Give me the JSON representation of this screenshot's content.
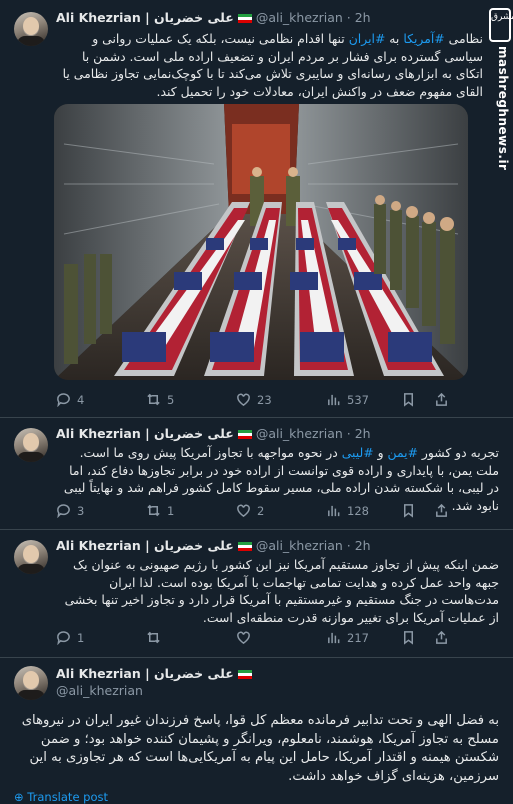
{
  "watermark": {
    "site": "mashreghnews.ir",
    "logo": "مشرق"
  },
  "author": {
    "name": "Ali Khezrian | علی خضریان",
    "handle": "@ali_khezrian",
    "dot": "·"
  },
  "tweets": [
    {
      "time": "2h",
      "text_html": "نظامی <span class=\"tag\">#آمریکا</span> به <span class=\"tag\">#ایران</span> تنها اقدام نظامی نیست، بلکه یک عملیات روانی و سیاسی گسترده برای فشار بر مردم ایران و تضعیف اراده ملی است. دشمن با اتکای به ابزارهای رسانه‌ای و سایبری تلاش می‌کند تا با کوچک‌نمایی تجاوز نظامی یا القای مفهوم ضعف در واکنش ایران، معادلات خود را تحمیل کند.",
      "stats": {
        "replies": "4",
        "reposts": "5",
        "likes": "23",
        "views": "537"
      }
    },
    {
      "time": "2h",
      "text_html": "تجربه دو کشور <span class=\"tag\">#یمن</span> و <span class=\"tag\">#لیبی</span> در نحوه مواجهه با تجاوز آمریکا پیش روی ما است. ملت یمن، با پایداری و اراده قوی توانست از اراده خود در برابر تجاوزها دفاع کند، اما در لیبی، با شکسته شدن اراده ملی، مسیر سقوط کامل کشور فراهم شد و نهایتاً لیبی نابود شد.",
      "stats": {
        "replies": "3",
        "reposts": "1",
        "likes": "2",
        "views": "128"
      }
    },
    {
      "time": "2h",
      "text_html": "ضمن اینکه پیش از تجاوز مستقیم آمریکا نیز این کشور با رژیم صهیونی به عنوان یک جبهه واحد عمل کرده و هدایت تمامی تهاجمات با آمریکا بوده است. لذا ایران مدت‌هاست در جنگ مستقیم و غیرمستقیم با آمریکا قرار دارد و تجاوز اخیر تنها بخشی از عملیات آمریکا برای تغییر موازنه قدرت منطقه‌ای است.",
      "stats": {
        "replies": "1",
        "reposts": "",
        "likes": "",
        "views": "217"
      }
    },
    {
      "text_html": "به فضل الهی و تحت تدابیر فرمانده معظم کل قوا، پاسخ فرزندان غیور ایران در نیروهای مسلح به تجاوز آمریکا، هوشمند، نامعلوم، ویرانگر و پشیمان کننده خواهد بود؛ و ضمن شکستن هیمنه و اقتدار آمریکا، حامل این پیام به آمریکایی‌ها است که هر تجاوزی به این سرزمین، هزینه‌ای گزاف خواهد داشت.",
      "translate": "Translate post"
    }
  ]
}
